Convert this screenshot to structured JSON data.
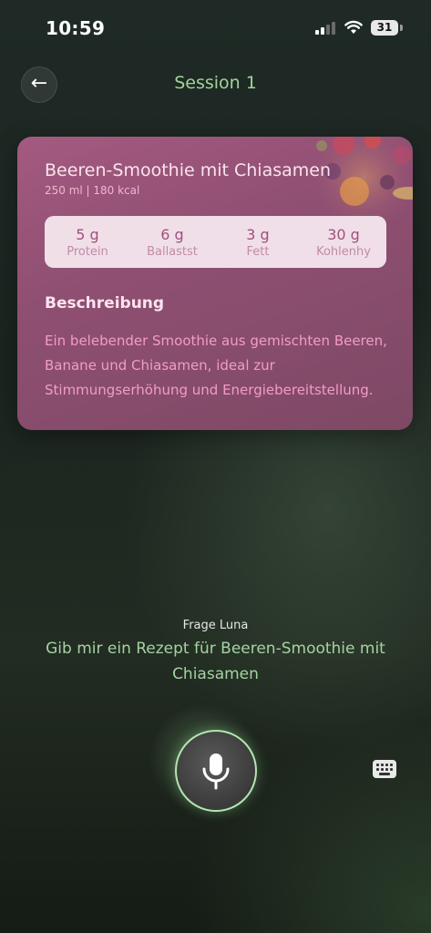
{
  "status_bar": {
    "time": "10:59",
    "battery": "31"
  },
  "header": {
    "title": "Session 1"
  },
  "recipe": {
    "title": "Beeren-Smoothie mit Chiasamen",
    "meta": "250 ml | 180 kcal",
    "nutrients": [
      {
        "value": "5 g",
        "label": "Protein"
      },
      {
        "value": "6 g",
        "label": "Ballastst"
      },
      {
        "value": "3 g",
        "label": "Fett"
      },
      {
        "value": "30 g",
        "label": "Kohlenhy"
      }
    ],
    "description_heading": "Beschreibung",
    "description": "Ein belebender Smoothie aus gemischten Beeren, Banane und Chiasamen, ideal zur Stimmungserhöhung und Energiebereitstellung."
  },
  "assistant": {
    "label": "Frage Luna",
    "query": "Gib mir ein Rezept für Beeren-Smoothie mit Chiasamen"
  },
  "colors": {
    "accent_green": "#9fd49b",
    "card_pink": "#9a5478",
    "mic_ring": "#b3e6b0"
  }
}
